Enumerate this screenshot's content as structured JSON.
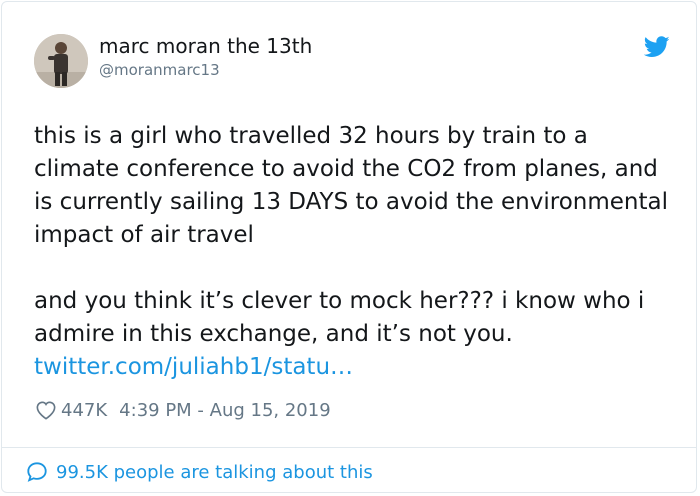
{
  "author": {
    "display_name": "marc moran the 13th",
    "handle": "@moranmarc13"
  },
  "tweet": {
    "paragraph_1": "this is a girl who travelled 32 hours by train to a climate conference to avoid the CO2 from planes, and is currently sailing 13 DAYS to avoid the environmental impact of air travel",
    "paragraph_2": "and you think it’s clever to mock her??? i know who i admire in this exchange, and it’s not you.",
    "link_text": "twitter.com/juliahb1/statu…"
  },
  "meta": {
    "likes": "447K",
    "timestamp": "4:39 PM - Aug 15, 2019"
  },
  "footer": {
    "talking_text": "99.5K people are talking about this"
  },
  "colors": {
    "twitter_blue": "#1da1f2",
    "link_blue": "#1b95e0",
    "muted_gray": "#657786",
    "text_dark": "#14171a",
    "border": "#e1e8ed"
  },
  "icons": {
    "brand": "twitter-bird-icon",
    "like": "heart-icon",
    "reply": "speech-bubble-icon"
  }
}
